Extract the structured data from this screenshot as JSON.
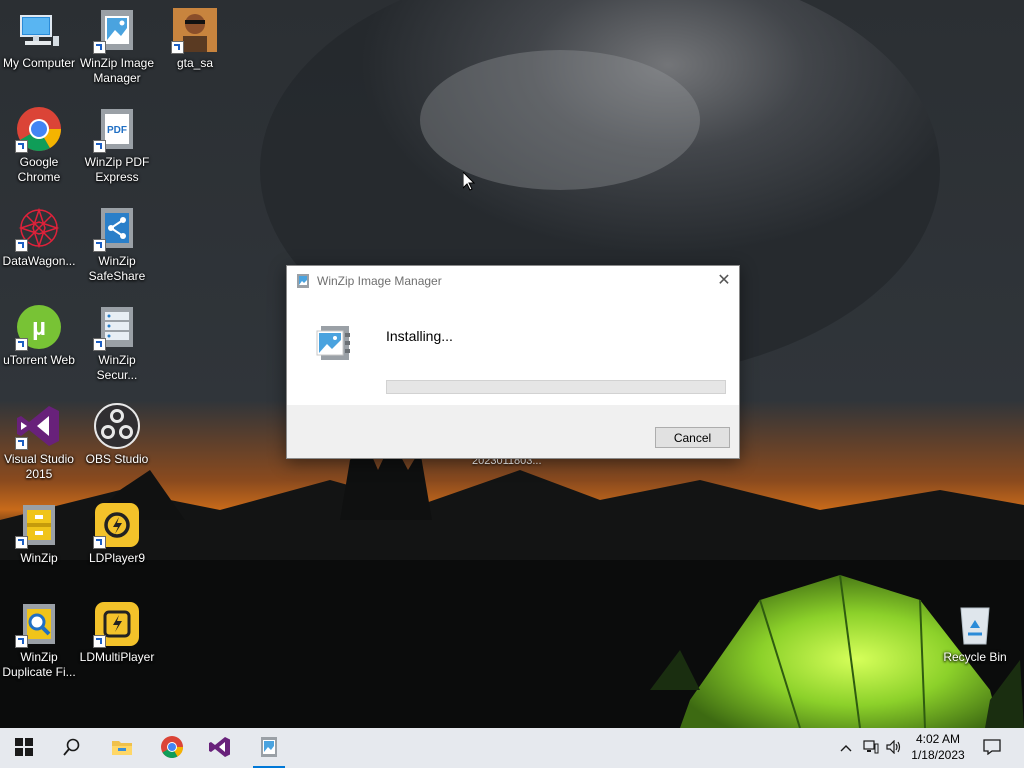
{
  "desktop": {
    "icons": [
      {
        "label": "My Computer"
      },
      {
        "label": "WinZip Image Manager"
      },
      {
        "label": "gta_sa"
      },
      {
        "label": "Google Chrome"
      },
      {
        "label": "WinZip PDF Express"
      },
      {
        "label": "DataWagon..."
      },
      {
        "label": "WinZip SafeShare"
      },
      {
        "label": "uTorrent Web"
      },
      {
        "label": "WinZip Secur..."
      },
      {
        "label": "Visual Studio 2015"
      },
      {
        "label": "OBS Studio"
      },
      {
        "label": "WinZip"
      },
      {
        "label": "LDPlayer9"
      },
      {
        "label": "WinZip Duplicate Fi..."
      },
      {
        "label": "LDMultiPlayer"
      },
      {
        "label": "Recycle Bin"
      }
    ],
    "partial_label": "2023011803..."
  },
  "dialog": {
    "title": "WinZip Image Manager",
    "status": "Installing...",
    "progress": 0,
    "cancel_label": "Cancel"
  },
  "taskbar": {
    "time": "4:02 AM",
    "date": "1/18/2023",
    "apps": [
      "start-icon",
      "search-icon",
      "file-explorer-icon",
      "chrome-icon",
      "visual-studio-icon",
      "winzip-image-manager-icon"
    ]
  },
  "colors": {
    "progress_track": "#e6e6e6",
    "taskbar_bg": "#e6e9ee",
    "accent": "#0078d7"
  }
}
